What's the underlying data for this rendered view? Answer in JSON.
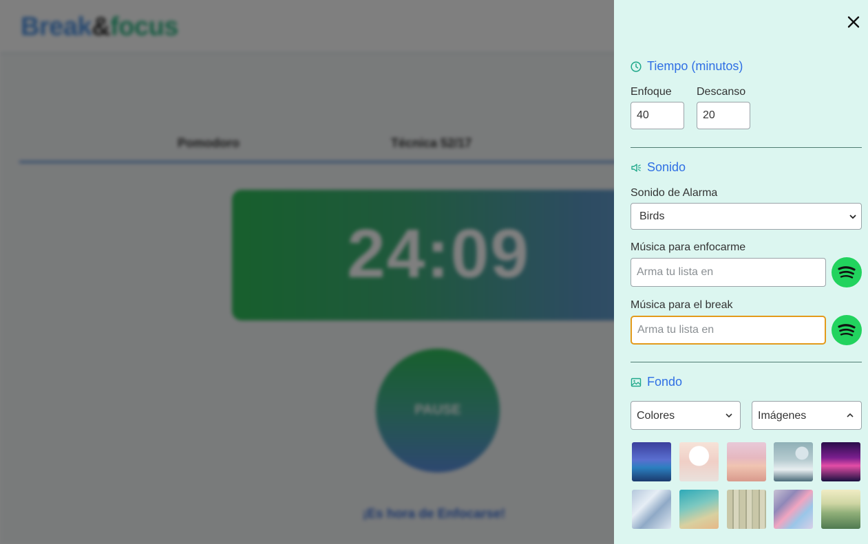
{
  "app": {
    "logo": {
      "part1": "Break",
      "part2": "&",
      "part3": "focus"
    },
    "tabs": [
      {
        "label": "Pomodoro"
      },
      {
        "label": "Técnica 52/17"
      }
    ],
    "timer": "24:09",
    "pause_label": "PAUSE",
    "focus_message": "¡Es hora de Enfocarse!"
  },
  "settings": {
    "time": {
      "title": "Tiempo (minutos)",
      "focus_label": "Enfoque",
      "focus_value": "40",
      "break_label": "Descanso",
      "break_value": "20"
    },
    "sound": {
      "title": "Sonido",
      "alarm_label": "Sonido de Alarma",
      "alarm_value": "Birds",
      "focus_music_label": "Música para enfocarme",
      "focus_music_placeholder": "Arma tu lista en",
      "break_music_label": "Música para el break",
      "break_music_placeholder": "Arma tu lista en"
    },
    "background": {
      "title": "Fondo",
      "colors_label": "Colores",
      "images_label": "Imágenes",
      "images": [
        {
          "name": "night-lake-mountains"
        },
        {
          "name": "cherry-blossom-moon"
        },
        {
          "name": "pink-flower-field"
        },
        {
          "name": "snowy-peaks-planet"
        },
        {
          "name": "neon-purple-mountains"
        },
        {
          "name": "frosted-ice-texture"
        },
        {
          "name": "teal-geometric-gradient"
        },
        {
          "name": "weathered-wood"
        },
        {
          "name": "holographic-gradient"
        },
        {
          "name": "green-rolling-hills"
        }
      ]
    }
  },
  "colors": {
    "panel_bg": "#dcf6f0",
    "accent_blue": "#2f6fe4",
    "focus_outline": "#e39a1a",
    "spotify_green": "#22d35e"
  }
}
